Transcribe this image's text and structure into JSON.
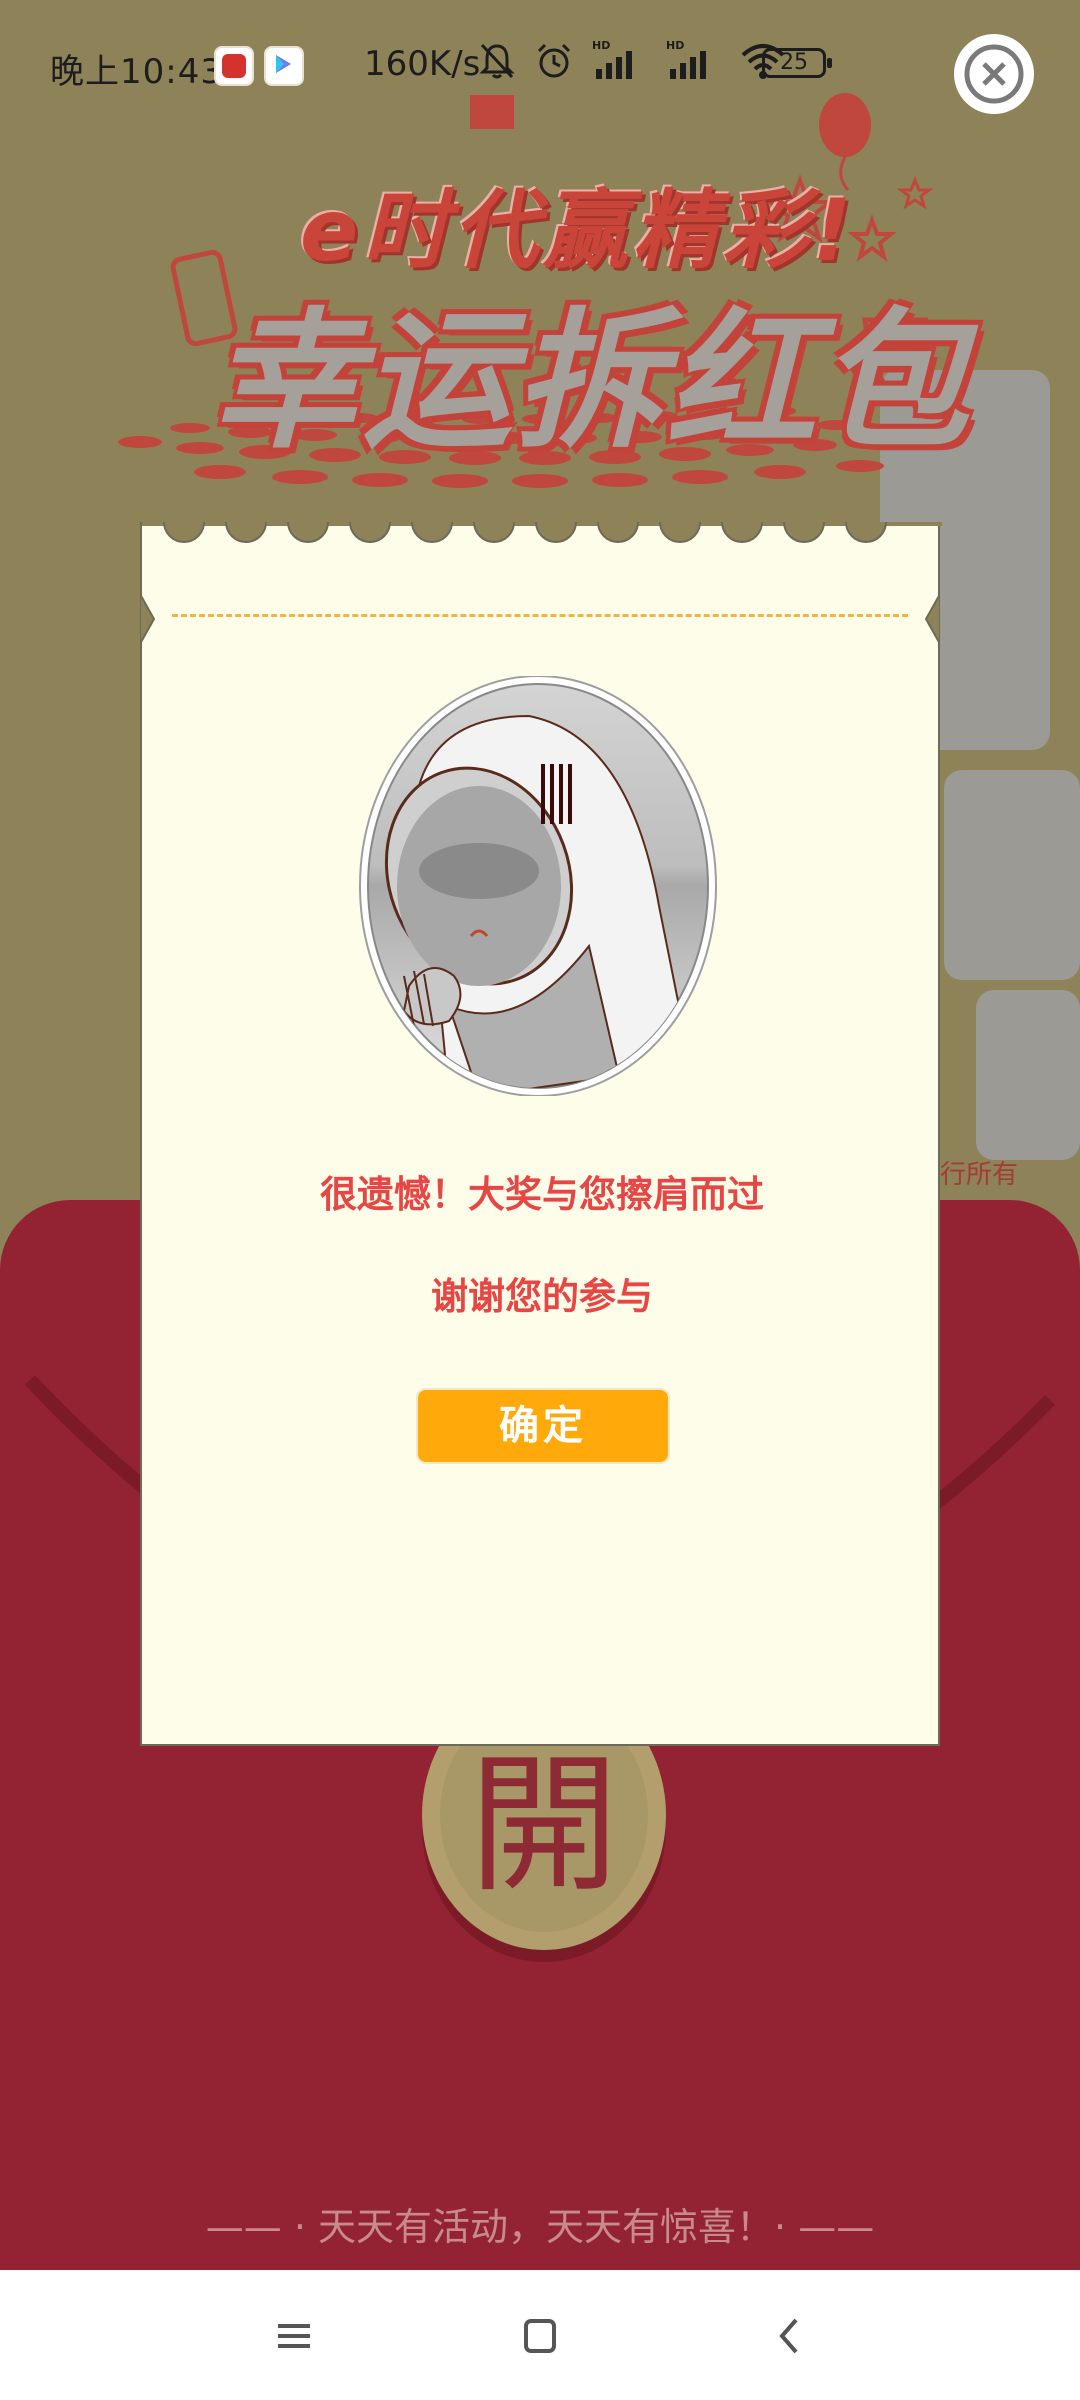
{
  "status_bar": {
    "time": "晚上10:43",
    "net_speed": "160K/s",
    "battery": "25"
  },
  "banner": {
    "line1": "e时代赢精彩!",
    "line2": "幸运拆红包"
  },
  "background": {
    "side_text": "行所有",
    "open_label": "開",
    "slogan": "—— · 天天有活动，天天有惊喜！· ——"
  },
  "dialog": {
    "title": "很遗憾！大奖与您擦肩而过",
    "subtitle": "谢谢您的参与",
    "confirm_label": "确定"
  },
  "icons": {
    "close": "close-circle-icon",
    "mute": "bell-off-icon",
    "alarm": "alarm-icon",
    "signal": "signal-icon",
    "wifi": "wifi-icon",
    "menu": "menu-icon",
    "home": "home-square-icon",
    "back": "back-chevron-icon"
  },
  "colors": {
    "background": "#8e8358",
    "envelope": "#932333",
    "dialog": "#fefde9",
    "accent_text": "#e84545",
    "button": "#ffa90a"
  }
}
